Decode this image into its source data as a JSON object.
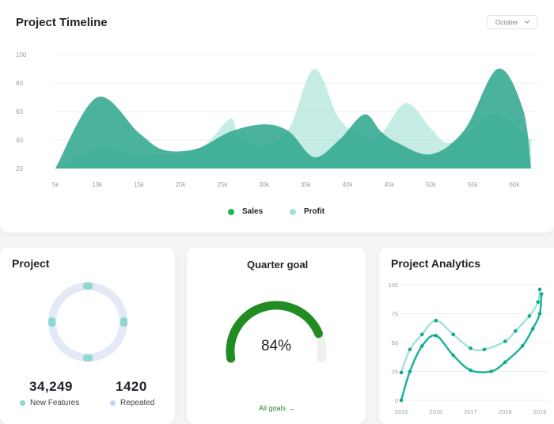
{
  "timeline": {
    "title": "Project Timeline",
    "month_select": "October",
    "chart_data": {
      "type": "area",
      "x": [
        5,
        10,
        15,
        20,
        25,
        30,
        35,
        40,
        45,
        50,
        55,
        60
      ],
      "x_tick_labels": [
        "5k",
        "10k",
        "15k",
        "20k",
        "25k",
        "30k",
        "35k",
        "40k",
        "45k",
        "50k",
        "55k",
        "60k"
      ],
      "y_tick_labels": [
        "100",
        "80",
        "60",
        "40",
        "20"
      ],
      "ylim": [
        20,
        100
      ],
      "grid": true,
      "legend": "bottom-center",
      "series": [
        {
          "name": "Sales",
          "color": "#2ca58d",
          "points": [
            [
              5,
              20
            ],
            [
              10,
              70
            ],
            [
              15,
              45
            ],
            [
              18,
              33
            ],
            [
              22,
              34
            ],
            [
              26,
              46
            ],
            [
              30,
              51
            ],
            [
              33,
              46
            ],
            [
              36,
              28
            ],
            [
              39,
              40
            ],
            [
              42,
              58
            ],
            [
              44,
              46
            ],
            [
              46,
              38
            ],
            [
              50,
              30
            ],
            [
              54,
              47
            ],
            [
              58,
              90
            ],
            [
              61,
              62
            ],
            [
              62,
              20
            ]
          ]
        },
        {
          "name": "Profit",
          "color": "#a6e3d7",
          "points": [
            [
              5,
              20
            ],
            [
              10,
              33
            ],
            [
              15,
              30
            ],
            [
              20,
              30
            ],
            [
              23,
              37
            ],
            [
              26,
              55
            ],
            [
              27,
              42
            ],
            [
              30,
              36
            ],
            [
              33,
              48
            ],
            [
              36,
              90
            ],
            [
              39,
              55
            ],
            [
              42,
              42
            ],
            [
              44,
              44
            ],
            [
              47,
              66
            ],
            [
              50,
              48
            ],
            [
              52,
              38
            ],
            [
              55,
              48
            ],
            [
              58,
              58
            ],
            [
              62,
              40
            ]
          ]
        }
      ]
    }
  },
  "project": {
    "title": "Project",
    "features_value": "34,249",
    "features_label": "New Features",
    "repeated_value": "1420",
    "repeated_label": "Repeated"
  },
  "goal": {
    "title": "Quarter goal",
    "value": 84,
    "value_label": "84%",
    "link_label": "All goals →"
  },
  "analytics": {
    "title": "Project Analytics",
    "chart_data": {
      "type": "line",
      "x_tick_labels": [
        "2015",
        "2016",
        "2017",
        "2018",
        "2019"
      ],
      "y_tick_labels": [
        "100",
        "75",
        "50",
        "25",
        "0"
      ],
      "ylim": [
        0,
        100
      ],
      "xlim": [
        2015,
        2019
      ],
      "grid": true,
      "series": [
        {
          "color": "#a2e4da",
          "points": [
            [
              2015,
              24
            ],
            [
              2015.25,
              44
            ],
            [
              2015.6,
              57
            ],
            [
              2016,
              69
            ],
            [
              2016.5,
              57
            ],
            [
              2017,
              45
            ],
            [
              2017.4,
              44
            ],
            [
              2018,
              51
            ],
            [
              2018.3,
              60
            ],
            [
              2018.7,
              73
            ],
            [
              2018.95,
              85
            ],
            [
              2019,
              96
            ]
          ]
        },
        {
          "color": "#1bb39a",
          "points": [
            [
              2015,
              0
            ],
            [
              2015.25,
              25
            ],
            [
              2015.6,
              47
            ],
            [
              2016,
              56
            ],
            [
              2016.5,
              39
            ],
            [
              2017,
              26
            ],
            [
              2017.6,
              25
            ],
            [
              2018,
              33
            ],
            [
              2018.5,
              47
            ],
            [
              2018.8,
              62
            ],
            [
              2019,
              75
            ],
            [
              2019.05,
              92
            ]
          ]
        }
      ]
    }
  }
}
